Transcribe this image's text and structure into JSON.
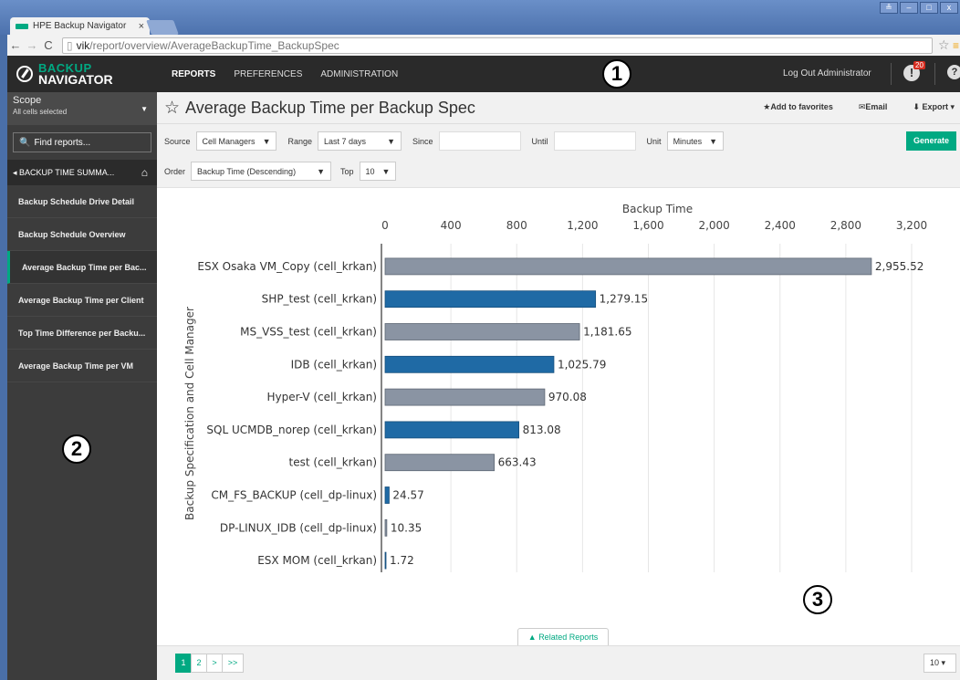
{
  "browser": {
    "tab_title": "HPE Backup Navigator",
    "tab_close": "×",
    "url_host": "vik",
    "url_path": "/report/overview/AverageBackupTime_BackupSpec",
    "win_buttons": [
      "≗",
      "–",
      "□",
      "x"
    ]
  },
  "app": {
    "logo_line1": "BACKUP",
    "logo_line2": "NAVIGATOR",
    "nav": [
      "REPORTS",
      "PREFERENCES",
      "ADMINISTRATION"
    ],
    "logout": "Log Out Administrator",
    "alert_count": "20",
    "callouts": [
      "1",
      "2",
      "3"
    ]
  },
  "sidebar": {
    "scope_label": "Scope",
    "scope_value": "All cells selected",
    "find_label": "Find reports...",
    "breadcrumb": "◂ BACKUP TIME SUMMA...",
    "items": [
      "Backup Schedule Drive Detail",
      "Backup Schedule Overview",
      "Average Backup Time per Bac...",
      "Average Backup Time per Client",
      "Top Time Difference per Backu...",
      "Average Backup Time per VM"
    ]
  },
  "page": {
    "title": "Average Backup Time per Backup Spec",
    "add_favorites": "Add to favorites",
    "email": "Email",
    "export": "Export",
    "filters": {
      "source_label": "Source",
      "source_value": "Cell Managers",
      "range_label": "Range",
      "range_value": "Last 7 days",
      "since_label": "Since",
      "until_label": "Until",
      "unit_label": "Unit",
      "unit_value": "Minutes",
      "order_label": "Order",
      "order_value": "Backup Time (Descending)",
      "top_label": "Top",
      "top_value": "10",
      "generate": "Generate"
    },
    "related": "Related Reports",
    "pager": [
      "1",
      "2",
      ">",
      ">>"
    ],
    "per_page": "10"
  },
  "colors": {
    "accent": "#01a982",
    "bar_gray": "#8a94a3",
    "bar_blue": "#1f6aa5"
  },
  "chart_data": {
    "type": "bar",
    "orientation": "horizontal",
    "xlabel": "Backup Time",
    "ylabel": "Backup Specification and Cell Manager",
    "xlim": [
      0,
      3200
    ],
    "xticks": [
      "0",
      "400",
      "800",
      "1,200",
      "1,600",
      "2,000",
      "2,400",
      "2,800",
      "3,200"
    ],
    "grid": true,
    "categories": [
      "ESX Osaka VM_Copy (cell_krkan)",
      "SHP_test (cell_krkan)",
      "MS_VSS_test (cell_krkan)",
      "IDB (cell_krkan)",
      "Hyper-V (cell_krkan)",
      "SQL UCMDB_norep (cell_krkan)",
      "test (cell_krkan)",
      "CM_FS_BACKUP (cell_dp-linux)",
      "DP-LINUX_IDB (cell_dp-linux)",
      "ESX MOM (cell_krkan)"
    ],
    "values": [
      2955.52,
      1279.15,
      1181.65,
      1025.79,
      970.08,
      813.08,
      663.43,
      24.57,
      10.35,
      1.72
    ],
    "labels": [
      "2,955.52",
      "1,279.15",
      "1,181.65",
      "1,025.79",
      "970.08",
      "813.08",
      "663.43",
      "24.57",
      "10.35",
      "1.72"
    ],
    "bar_colors": [
      "gray",
      "blue",
      "gray",
      "blue",
      "gray",
      "blue",
      "gray",
      "blue",
      "gray",
      "blue"
    ]
  }
}
